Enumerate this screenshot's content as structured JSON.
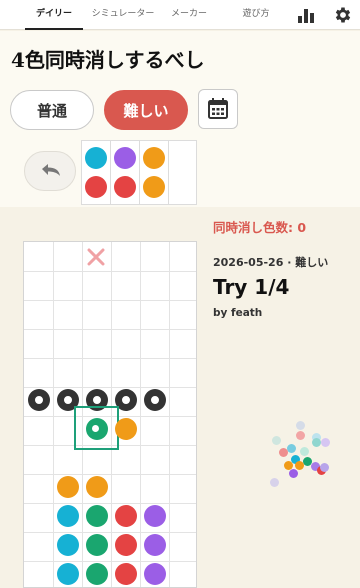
{
  "nav": {
    "tabs": [
      {
        "label": "デイリー"
      },
      {
        "label": "シミュレーター"
      },
      {
        "label": "メーカー"
      },
      {
        "label": "遊び方"
      }
    ],
    "icons": [
      "bar-chart-icon",
      "gear-icon"
    ]
  },
  "puzzle": {
    "title": "4色同時消しするべし"
  },
  "difficulty": {
    "normal": "普通",
    "hard": "難しい",
    "selected": "hard"
  },
  "colors": {
    "cyan": "#16b1d4",
    "purple": "#9b5ee6",
    "orange": "#f09b18",
    "red": "#e44343",
    "green": "#1aa66f",
    "accent": "#d9584f"
  },
  "queue": {
    "pairs": [
      [
        "cyan",
        "red"
      ],
      [
        "purple",
        "red"
      ],
      [
        "orange",
        "orange"
      ]
    ]
  },
  "info": {
    "simul_label": "同時消し色数: 0",
    "date_diff": "2026-05-26 · 難しい",
    "try": "Try 1/4",
    "by": "by feath"
  }
}
